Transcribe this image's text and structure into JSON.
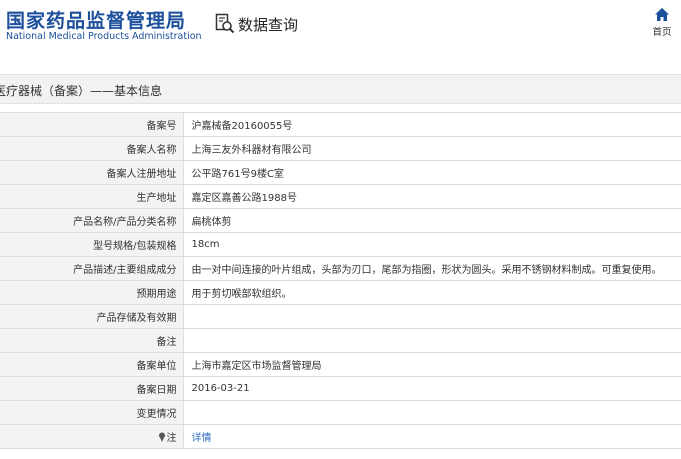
{
  "header": {
    "logo_cn": "国家药品监督管理局",
    "logo_en": "National Medical Products Administration",
    "query_label": "数据查询",
    "home_label": "首页"
  },
  "title": "医疗器械（备案）——基本信息",
  "rows": [
    {
      "label": "备案号",
      "value": "沪嘉械备20160055号"
    },
    {
      "label": "备案人名称",
      "value": "上海三友外科器材有限公司"
    },
    {
      "label": "备案人注册地址",
      "value": "公平路761号9楼C室"
    },
    {
      "label": "生产地址",
      "value": "嘉定区嘉善公路1988号"
    },
    {
      "label": "产品名称/产品分类名称",
      "value": "扁桃体剪"
    },
    {
      "label": "型号规格/包装规格",
      "value": "18cm"
    },
    {
      "label": "产品描述/主要组成成分",
      "value": "由一对中间连接的叶片组成，头部为刃口，尾部为指圈，形状为圆头。采用不锈钢材料制成。可重复使用。"
    },
    {
      "label": "预期用途",
      "value": "用于剪切喉部软组织。"
    },
    {
      "label": "产品存储及有效期",
      "value": ""
    },
    {
      "label": "备注",
      "value": ""
    },
    {
      "label": "备案单位",
      "value": "上海市嘉定区市场监督管理局"
    },
    {
      "label": "备案日期",
      "value": "2016-03-21"
    },
    {
      "label": "变更情况",
      "value": ""
    }
  ],
  "note_row": {
    "label": "注",
    "link_text": "详情"
  },
  "colors": {
    "brand": "#1c4f9c",
    "link": "#2a6cc4",
    "label_bg": "#f3f3f3"
  },
  "icons": {
    "query": "magnifier-document-icon",
    "home": "home-icon",
    "note": "pin-icon"
  }
}
